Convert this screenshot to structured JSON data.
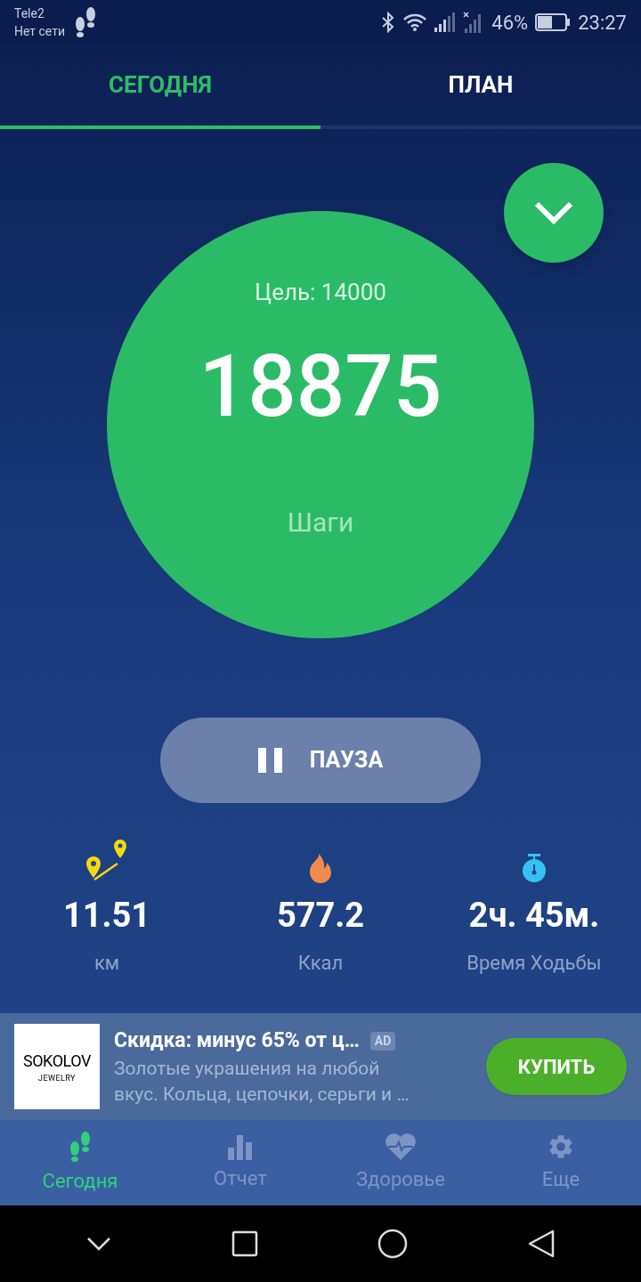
{
  "status_bar": {
    "carrier": "Tele2",
    "network": "Нет сети",
    "battery": "46%",
    "time": "23:27"
  },
  "tabs": [
    {
      "label": "СЕГОДНЯ",
      "selected": true
    },
    {
      "label": "ПЛАН",
      "selected": false
    }
  ],
  "counter": {
    "goal": "Цель: 14000",
    "steps": "18875",
    "unit": "Шаги"
  },
  "pause_button": "ПАУЗА",
  "stats": [
    {
      "kind": "distance",
      "value": "11.51",
      "label": "км"
    },
    {
      "kind": "calories",
      "value": "577.2",
      "label": "Ккал"
    },
    {
      "kind": "time",
      "value": "2ч. 45м.",
      "label": "Время Ходьбы"
    }
  ],
  "ad": {
    "logo": "SOKOLOV",
    "logo_sub": "JEWELRY",
    "title": "Скидка: минус 65% от ц…",
    "badge": "AD",
    "body": "Золотые украшения на любой вкус. Кольца, цепочки, серьги и …",
    "button": "КУПИТЬ"
  },
  "bottom_nav": [
    {
      "kind": "today",
      "label": "Сегодня",
      "selected": true
    },
    {
      "kind": "report",
      "label": "Отчет",
      "selected": false
    },
    {
      "kind": "health",
      "label": "Здоровье",
      "selected": false
    },
    {
      "kind": "more",
      "label": "Еще",
      "selected": false
    }
  ]
}
